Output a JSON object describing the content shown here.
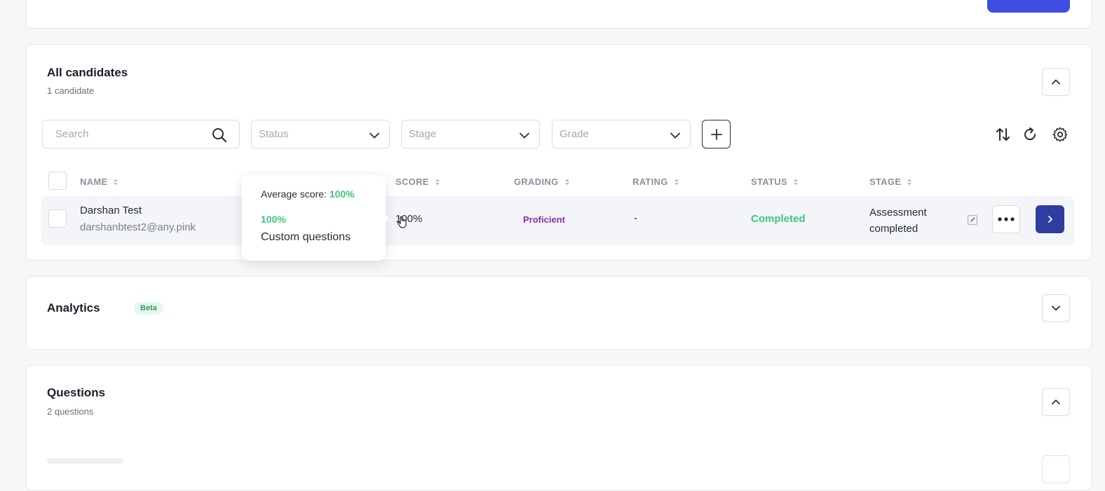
{
  "candidates_section": {
    "title": "All candidates",
    "count_label": "1 candidate",
    "search_placeholder": "Search",
    "filters": {
      "status_placeholder": "Status",
      "stage_placeholder": "Stage",
      "grade_placeholder": "Grade"
    },
    "columns": {
      "name": "NAME",
      "score": "SCORE",
      "grading": "GRADING",
      "rating": "RATING",
      "status": "STATUS",
      "stage": "STAGE"
    },
    "rows": [
      {
        "name": "Darshan Test",
        "email": "darshanbtest2@any.pink",
        "score": "100%",
        "grading": "Proficient",
        "rating": "-",
        "status": "Completed",
        "stage": "Assessment completed"
      }
    ]
  },
  "score_tooltip": {
    "average_label": "Average score:",
    "average_value": "100%",
    "section_score": "100%",
    "section_name": "Custom questions"
  },
  "analytics_section": {
    "title": "Analytics",
    "badge": "Beta"
  },
  "questions_section": {
    "title": "Questions",
    "count_label": "2 questions"
  },
  "colors": {
    "primary": "#3f4ee0",
    "accent_dark": "#2f3da0",
    "success": "#3cc77c",
    "grading_purple": "#8a2fb0"
  },
  "icons": {
    "search": "search-icon",
    "sort": "sort-icon",
    "refresh": "refresh-icon",
    "settings": "gear-icon",
    "add": "plus-icon",
    "collapse": "chevron-up-icon",
    "expand": "chevron-down-icon",
    "more": "more-dots-icon",
    "open": "chevron-right-icon",
    "edit": "edit-icon"
  }
}
